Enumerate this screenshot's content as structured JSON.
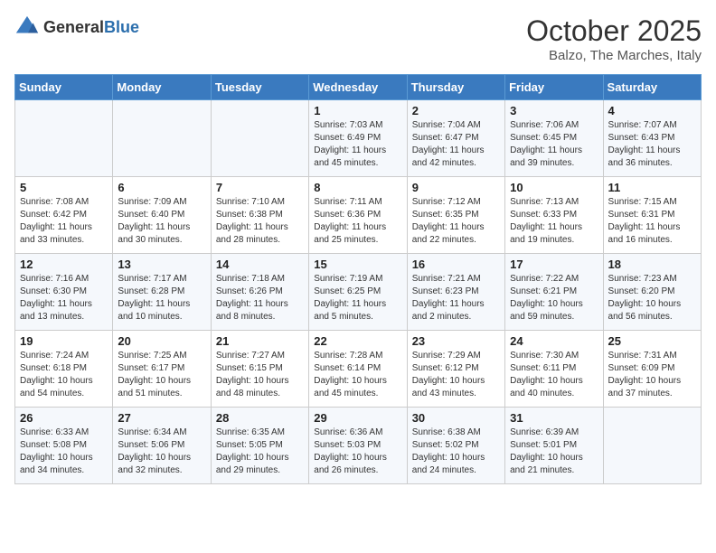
{
  "logo": {
    "general": "General",
    "blue": "Blue"
  },
  "title": "October 2025",
  "location": "Balzo, The Marches, Italy",
  "days_header": [
    "Sunday",
    "Monday",
    "Tuesday",
    "Wednesday",
    "Thursday",
    "Friday",
    "Saturday"
  ],
  "weeks": [
    [
      {
        "day": "",
        "info": ""
      },
      {
        "day": "",
        "info": ""
      },
      {
        "day": "",
        "info": ""
      },
      {
        "day": "1",
        "info": "Sunrise: 7:03 AM\nSunset: 6:49 PM\nDaylight: 11 hours and 45 minutes."
      },
      {
        "day": "2",
        "info": "Sunrise: 7:04 AM\nSunset: 6:47 PM\nDaylight: 11 hours and 42 minutes."
      },
      {
        "day": "3",
        "info": "Sunrise: 7:06 AM\nSunset: 6:45 PM\nDaylight: 11 hours and 39 minutes."
      },
      {
        "day": "4",
        "info": "Sunrise: 7:07 AM\nSunset: 6:43 PM\nDaylight: 11 hours and 36 minutes."
      }
    ],
    [
      {
        "day": "5",
        "info": "Sunrise: 7:08 AM\nSunset: 6:42 PM\nDaylight: 11 hours and 33 minutes."
      },
      {
        "day": "6",
        "info": "Sunrise: 7:09 AM\nSunset: 6:40 PM\nDaylight: 11 hours and 30 minutes."
      },
      {
        "day": "7",
        "info": "Sunrise: 7:10 AM\nSunset: 6:38 PM\nDaylight: 11 hours and 28 minutes."
      },
      {
        "day": "8",
        "info": "Sunrise: 7:11 AM\nSunset: 6:36 PM\nDaylight: 11 hours and 25 minutes."
      },
      {
        "day": "9",
        "info": "Sunrise: 7:12 AM\nSunset: 6:35 PM\nDaylight: 11 hours and 22 minutes."
      },
      {
        "day": "10",
        "info": "Sunrise: 7:13 AM\nSunset: 6:33 PM\nDaylight: 11 hours and 19 minutes."
      },
      {
        "day": "11",
        "info": "Sunrise: 7:15 AM\nSunset: 6:31 PM\nDaylight: 11 hours and 16 minutes."
      }
    ],
    [
      {
        "day": "12",
        "info": "Sunrise: 7:16 AM\nSunset: 6:30 PM\nDaylight: 11 hours and 13 minutes."
      },
      {
        "day": "13",
        "info": "Sunrise: 7:17 AM\nSunset: 6:28 PM\nDaylight: 11 hours and 10 minutes."
      },
      {
        "day": "14",
        "info": "Sunrise: 7:18 AM\nSunset: 6:26 PM\nDaylight: 11 hours and 8 minutes."
      },
      {
        "day": "15",
        "info": "Sunrise: 7:19 AM\nSunset: 6:25 PM\nDaylight: 11 hours and 5 minutes."
      },
      {
        "day": "16",
        "info": "Sunrise: 7:21 AM\nSunset: 6:23 PM\nDaylight: 11 hours and 2 minutes."
      },
      {
        "day": "17",
        "info": "Sunrise: 7:22 AM\nSunset: 6:21 PM\nDaylight: 10 hours and 59 minutes."
      },
      {
        "day": "18",
        "info": "Sunrise: 7:23 AM\nSunset: 6:20 PM\nDaylight: 10 hours and 56 minutes."
      }
    ],
    [
      {
        "day": "19",
        "info": "Sunrise: 7:24 AM\nSunset: 6:18 PM\nDaylight: 10 hours and 54 minutes."
      },
      {
        "day": "20",
        "info": "Sunrise: 7:25 AM\nSunset: 6:17 PM\nDaylight: 10 hours and 51 minutes."
      },
      {
        "day": "21",
        "info": "Sunrise: 7:27 AM\nSunset: 6:15 PM\nDaylight: 10 hours and 48 minutes."
      },
      {
        "day": "22",
        "info": "Sunrise: 7:28 AM\nSunset: 6:14 PM\nDaylight: 10 hours and 45 minutes."
      },
      {
        "day": "23",
        "info": "Sunrise: 7:29 AM\nSunset: 6:12 PM\nDaylight: 10 hours and 43 minutes."
      },
      {
        "day": "24",
        "info": "Sunrise: 7:30 AM\nSunset: 6:11 PM\nDaylight: 10 hours and 40 minutes."
      },
      {
        "day": "25",
        "info": "Sunrise: 7:31 AM\nSunset: 6:09 PM\nDaylight: 10 hours and 37 minutes."
      }
    ],
    [
      {
        "day": "26",
        "info": "Sunrise: 6:33 AM\nSunset: 5:08 PM\nDaylight: 10 hours and 34 minutes."
      },
      {
        "day": "27",
        "info": "Sunrise: 6:34 AM\nSunset: 5:06 PM\nDaylight: 10 hours and 32 minutes."
      },
      {
        "day": "28",
        "info": "Sunrise: 6:35 AM\nSunset: 5:05 PM\nDaylight: 10 hours and 29 minutes."
      },
      {
        "day": "29",
        "info": "Sunrise: 6:36 AM\nSunset: 5:03 PM\nDaylight: 10 hours and 26 minutes."
      },
      {
        "day": "30",
        "info": "Sunrise: 6:38 AM\nSunset: 5:02 PM\nDaylight: 10 hours and 24 minutes."
      },
      {
        "day": "31",
        "info": "Sunrise: 6:39 AM\nSunset: 5:01 PM\nDaylight: 10 hours and 21 minutes."
      },
      {
        "day": "",
        "info": ""
      }
    ]
  ]
}
